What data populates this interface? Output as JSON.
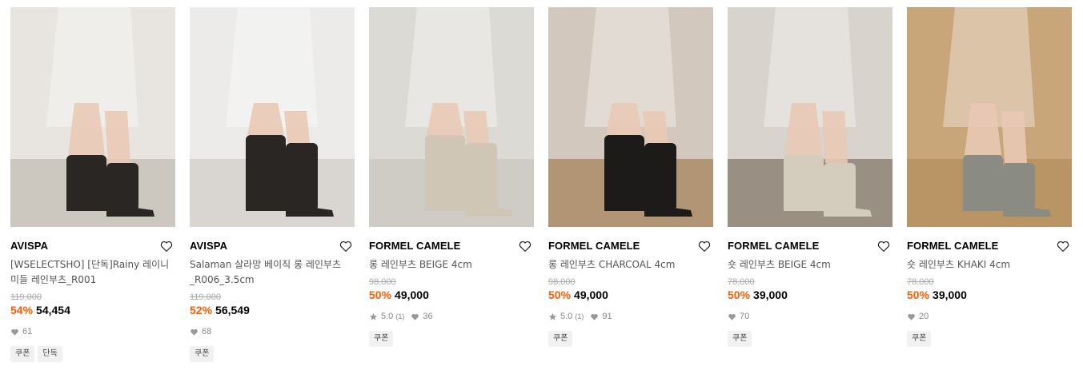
{
  "products": [
    {
      "brand": "AVISPA",
      "title": "[WSELECTSHO] [단독]Rainy 레이니 미들 레인부츠_R001",
      "original_price": "119,000",
      "discount": "54%",
      "price": "54,454",
      "rating": "",
      "reviews": "",
      "likes": "61",
      "tags": [
        "쿠폰",
        "단독"
      ],
      "image_colors": {
        "bg": "#e8e5e0",
        "boot": "#2a2624",
        "floor": "#bdb7ae"
      }
    },
    {
      "brand": "AVISPA",
      "title": "Salaman 살라망 베이직 롱 레인부츠_R006_3.5cm",
      "original_price": "119,000",
      "discount": "52%",
      "price": "56,549",
      "rating": "",
      "reviews": "",
      "likes": "68",
      "tags": [
        "쿠폰"
      ],
      "image_colors": {
        "bg": "#ecebe9",
        "boot": "#2a2624",
        "floor": "#cfcac4"
      }
    },
    {
      "brand": "FORMEL CAMELE",
      "title": "롱 레인부츠 BEIGE 4cm",
      "original_price": "98,000",
      "discount": "50%",
      "price": "49,000",
      "rating": "5.0",
      "reviews": "(1)",
      "likes": "36",
      "tags": [
        "쿠폰"
      ],
      "image_colors": {
        "bg": "#dcdad5",
        "boot": "#cfc6b5",
        "floor": "#c7c3bd"
      }
    },
    {
      "brand": "FORMEL CAMELE",
      "title": "롱 레인부츠 CHARCOAL 4cm",
      "original_price": "98,000",
      "discount": "50%",
      "price": "49,000",
      "rating": "5.0",
      "reviews": "(1)",
      "likes": "91",
      "tags": [
        "쿠폰"
      ],
      "image_colors": {
        "bg": "#d2c8bd",
        "boot": "#1d1b1a",
        "floor": "#a07a4e"
      }
    },
    {
      "brand": "FORMEL CAMELE",
      "title": "숏 레인부츠 BEIGE 4cm",
      "original_price": "78,000",
      "discount": "50%",
      "price": "39,000",
      "rating": "",
      "reviews": "",
      "likes": "70",
      "tags": [
        "쿠폰"
      ],
      "image_colors": {
        "bg": "#d8d3cd",
        "boot": "#d4ccbc",
        "floor": "#7a6a5a"
      }
    },
    {
      "brand": "FORMEL CAMELE",
      "title": "숏 레인부츠 KHAKI 4cm",
      "original_price": "78,000",
      "discount": "50%",
      "price": "39,000",
      "rating": "",
      "reviews": "",
      "likes": "20",
      "tags": [
        "쿠폰"
      ],
      "image_colors": {
        "bg": "#c9a57a",
        "boot": "#8a8c84",
        "floor": "#b08a5a"
      }
    }
  ],
  "colors": {
    "discount": "#ff5a00",
    "muted": "#888888",
    "strike": "#aaaaaa"
  },
  "icons": {
    "wishlist": "heart-outline-icon",
    "like": "heart-filled-icon",
    "rating": "star-icon"
  }
}
